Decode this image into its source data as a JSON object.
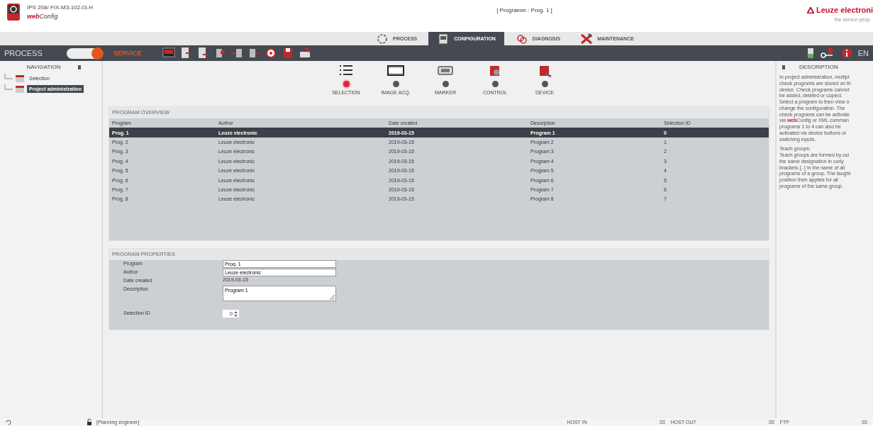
{
  "header": {
    "device": "IPS 208/ FIX-M3-102-I3-H",
    "app_name": "**web**Config",
    "program_title": "[ Programm : Prog. 1 ]",
    "brand": "Leuze electroni",
    "tagline": "the sensor peop"
  },
  "main_tabs": [
    {
      "label": "PROCESS",
      "selected": false
    },
    {
      "label": "CONFIGURATION",
      "selected": true
    },
    {
      "label": "DIAGNOSIS",
      "selected": false
    },
    {
      "label": "MAINTENANCE",
      "selected": false
    }
  ],
  "toolbar": {
    "process_label": "PROCESS",
    "service_label": "SERVICE",
    "service_mode": true,
    "language": "EN"
  },
  "navigation": {
    "title": "NAVIGATION",
    "items": [
      {
        "label": "Selection",
        "selected": false
      },
      {
        "label": "Project administration",
        "selected": true
      }
    ]
  },
  "steps": [
    {
      "label": "SELECTION",
      "selected": true
    },
    {
      "label": "IMAGE ACQ.",
      "selected": false
    },
    {
      "label": "MARKER",
      "selected": false
    },
    {
      "label": "CONTROL",
      "selected": false
    },
    {
      "label": "DEVICE",
      "selected": false
    }
  ],
  "overview": {
    "title": "PROGRAM OVERVIEW",
    "columns": [
      "Program",
      "Author",
      "Date created",
      "Description",
      "Selection ID"
    ],
    "rows": [
      {
        "cells": [
          "Prog. 1",
          "Leuze electronic",
          "2019-03-15",
          "Program 1",
          "0"
        ],
        "selected": true
      },
      {
        "cells": [
          "Prog. 2",
          "Leuze electronic",
          "2019-03-15",
          "Program 2",
          "1"
        ],
        "selected": false
      },
      {
        "cells": [
          "Prog. 3",
          "Leuze electronic",
          "2019-03-15",
          "Program 3",
          "2"
        ],
        "selected": false
      },
      {
        "cells": [
          "Prog. 4",
          "Leuze electronic",
          "2019-03-15",
          "Program 4",
          "3"
        ],
        "selected": false
      },
      {
        "cells": [
          "Prog. 5",
          "Leuze electronic",
          "2019-03-15",
          "Program 5",
          "4"
        ],
        "selected": false
      },
      {
        "cells": [
          "Prog. 6",
          "Leuze electronic",
          "2019-03-15",
          "Program 6",
          "5"
        ],
        "selected": false
      },
      {
        "cells": [
          "Prog. 7",
          "Leuze electronic",
          "2019-03-15",
          "Program 7",
          "6"
        ],
        "selected": false
      },
      {
        "cells": [
          "Prog. 8",
          "Leuze electronic",
          "2019-03-15",
          "Program 8",
          "7"
        ],
        "selected": false
      }
    ]
  },
  "properties": {
    "title": "PROGRAM PROPERTIES",
    "fields": [
      {
        "kind": "text",
        "label": "Program",
        "value": "Prog. 1"
      },
      {
        "kind": "text",
        "label": "Author",
        "value": "Leuze electronic"
      },
      {
        "kind": "static",
        "label": "Date created",
        "value": "2019-03-15"
      },
      {
        "kind": "textarea",
        "label": "Description",
        "value": "Program 1"
      },
      {
        "kind": "spinner",
        "label": "Selection ID",
        "value": "0"
      }
    ]
  },
  "description": {
    "title": "DESCRIPTION",
    "paragraphs": [
      [
        "In project administration, multipl",
        "check programs are stored on th",
        "device. Check programs cannot",
        "be added, deleted or copied.",
        "Select a program to then view o",
        "change the configuration. The",
        "check programs can be activate",
        "via **web**Config or XML comman",
        "programs 1 to 4 can also be",
        "activated via device buttons or",
        "switching inputs."
      ],
      [
        "Teach groups:",
        "Teach groups are formed by usi",
        "the same designation in curly",
        "brackets {..} in the name of all",
        "programs of a group. The taught",
        "position then applies for all",
        "programs of the same group."
      ]
    ]
  },
  "status_bar": {
    "user": "[Planning engineer]",
    "items": [
      "HOST IN",
      "HOST OUT",
      "FTP"
    ]
  }
}
